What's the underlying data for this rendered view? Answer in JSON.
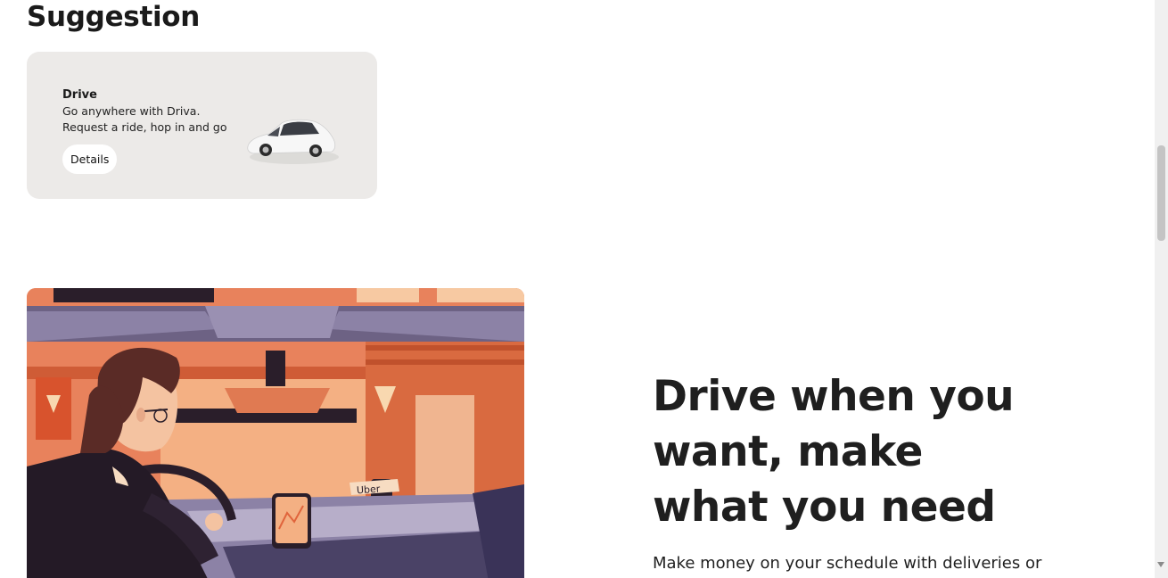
{
  "suggestion": {
    "title": "Suggestion",
    "card": {
      "title": "Drive",
      "description": "Go anywhere with Driva. Request a ride, hop in and go",
      "button_label": "Details",
      "illustration": "white-car-icon"
    }
  },
  "hero": {
    "heading": "Drive when you want, make what you need",
    "subtext": "Make money on your schedule with deliveries or",
    "illustration": "driver-in-car-illustration",
    "sign_text": "Uber"
  },
  "colors": {
    "card_bg": "#eceae8",
    "text": "#1f1f1f",
    "illustration_orange": "#e0643c",
    "illustration_purple": "#8c82a6",
    "illustration_peach": "#f4b083"
  }
}
